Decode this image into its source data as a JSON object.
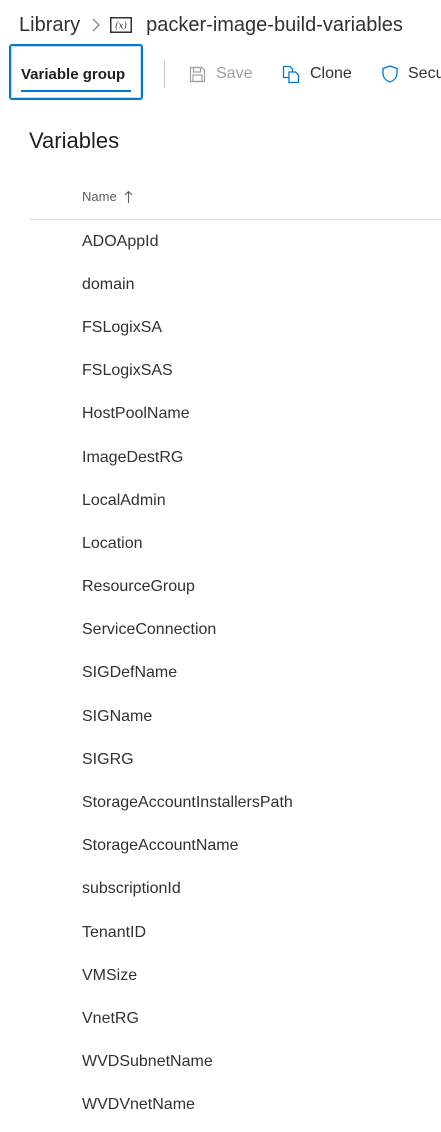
{
  "breadcrumb": {
    "library": "Library",
    "separator_icon": "chevron-right-icon",
    "group_icon": "variable-group-icon",
    "title": "packer-image-build-variables"
  },
  "toolbar": {
    "tab_label": "Variable group",
    "save_label": "Save",
    "save_icon": "save-icon",
    "clone_label": "Clone",
    "clone_icon": "clone-icon",
    "security_label": "Secu",
    "security_icon": "shield-icon"
  },
  "section": {
    "title": "Variables"
  },
  "table": {
    "column_name": "Name",
    "sort_icon": "sort-ascending-icon",
    "rows": [
      "ADOAppId",
      "domain",
      "FSLogixSA",
      "FSLogixSAS",
      "HostPoolName",
      "ImageDestRG",
      "LocalAdmin",
      "Location",
      "ResourceGroup",
      "ServiceConnection",
      "SIGDefName",
      "SIGName",
      "SIGRG",
      "StorageAccountInstallersPath",
      "StorageAccountName",
      "subscriptionId",
      "TenantID",
      "VMSize",
      "VnetRG",
      "WVDSubnetName",
      "WVDVnetName"
    ]
  },
  "colors": {
    "accent": "#0078d4",
    "text": "#323130",
    "disabled": "#a19f9d"
  }
}
